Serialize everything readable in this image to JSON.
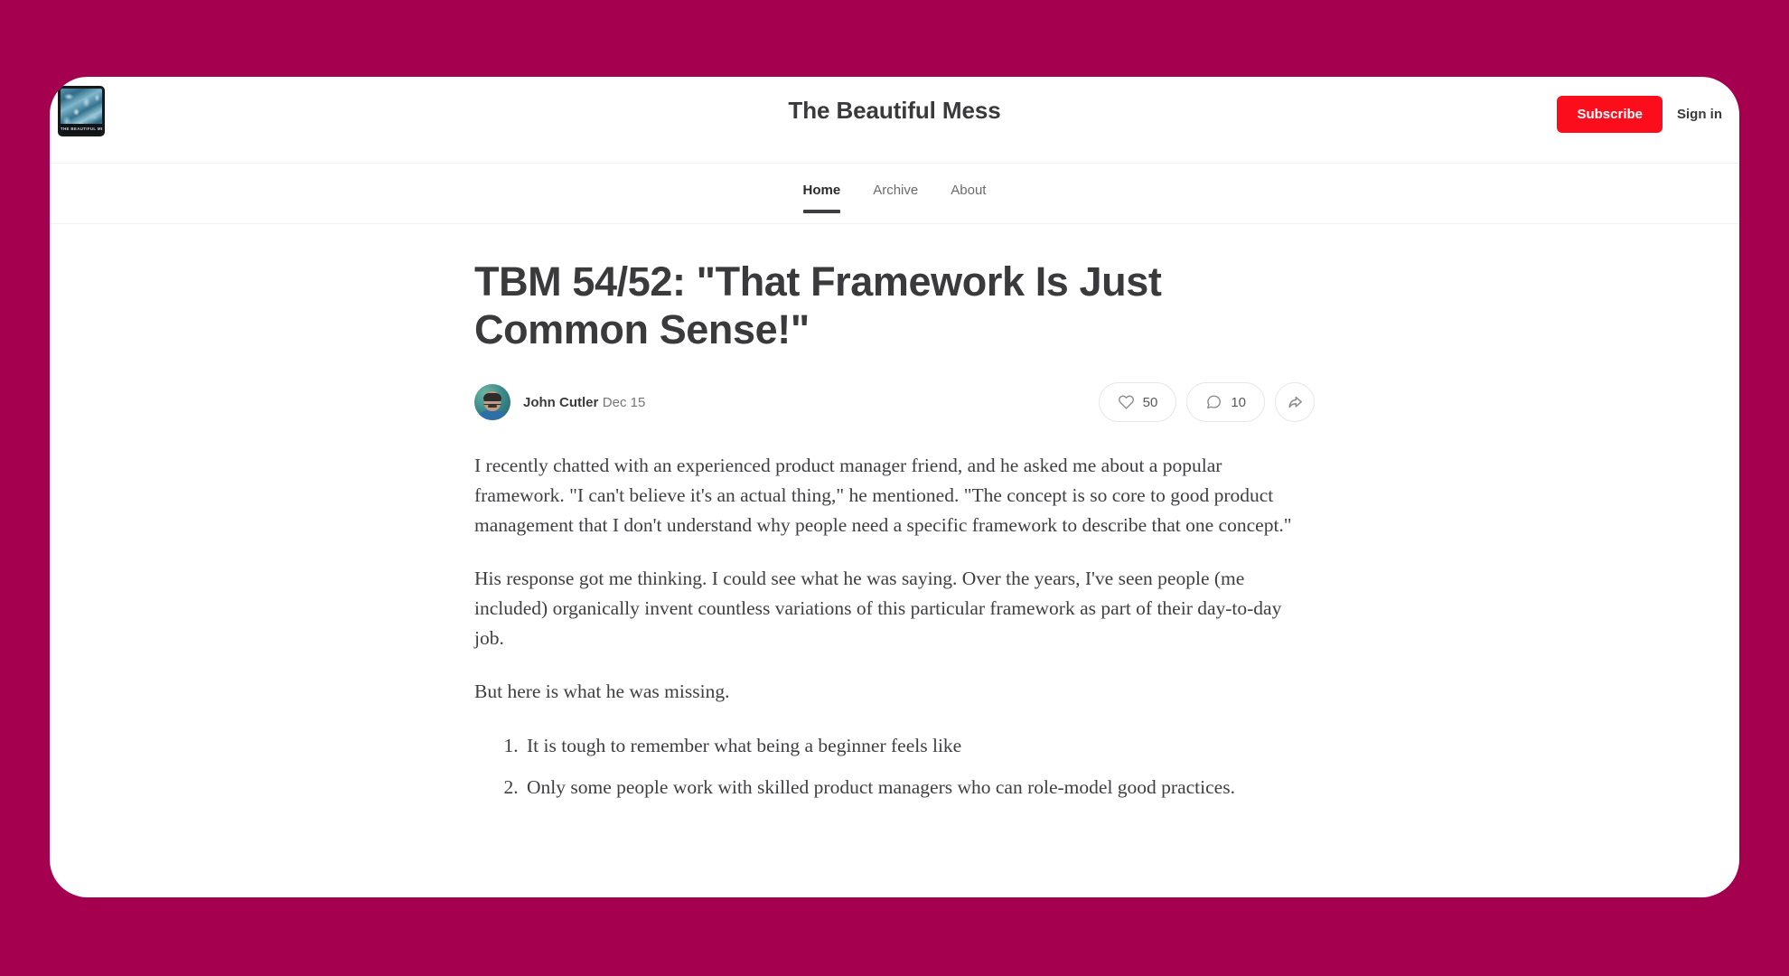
{
  "theme": {
    "page_background": "#a50050",
    "card_background": "#ffffff",
    "subscribe_color": "#fc0d1b",
    "text_color": "#3a3a3c",
    "muted_text_color": "#74747a"
  },
  "header": {
    "logo": {
      "icon": "publication-logo-image",
      "caption": "THE BEAUTIFUL MESS"
    },
    "title": "The Beautiful Mess",
    "subscribe_label": "Subscribe",
    "signin_label": "Sign in"
  },
  "nav": {
    "items": [
      {
        "label": "Home",
        "active": true
      },
      {
        "label": "Archive",
        "active": false
      },
      {
        "label": "About",
        "active": false
      }
    ]
  },
  "post": {
    "title": "TBM 54/52: \"That Framework Is Just Common Sense!\"",
    "author": "John Cutler",
    "date": "Dec 15",
    "avatar_icon": "author-avatar-photo",
    "actions": [
      {
        "name": "like",
        "icon": "heart-icon",
        "count": "50"
      },
      {
        "name": "comment",
        "icon": "comment-icon",
        "count": "10"
      },
      {
        "name": "share",
        "icon": "share-icon",
        "count": ""
      }
    ],
    "paragraphs": [
      "I recently chatted with an experienced product manager friend, and he asked me about a popular framework. \"I can't believe it's an actual thing,\" he mentioned. \"The concept is so core to good product management that I don't understand why people need a specific framework to describe that one concept.\"",
      "His response got me thinking. I could see what he was saying. Over the years, I've seen people (me included) organically invent countless variations of this particular framework as part of their day-to-day job.",
      "But here is what he was missing."
    ],
    "list_items": [
      "It is tough to remember what being a beginner feels like",
      "Only some people work with skilled product managers who can role-model good practices."
    ]
  }
}
